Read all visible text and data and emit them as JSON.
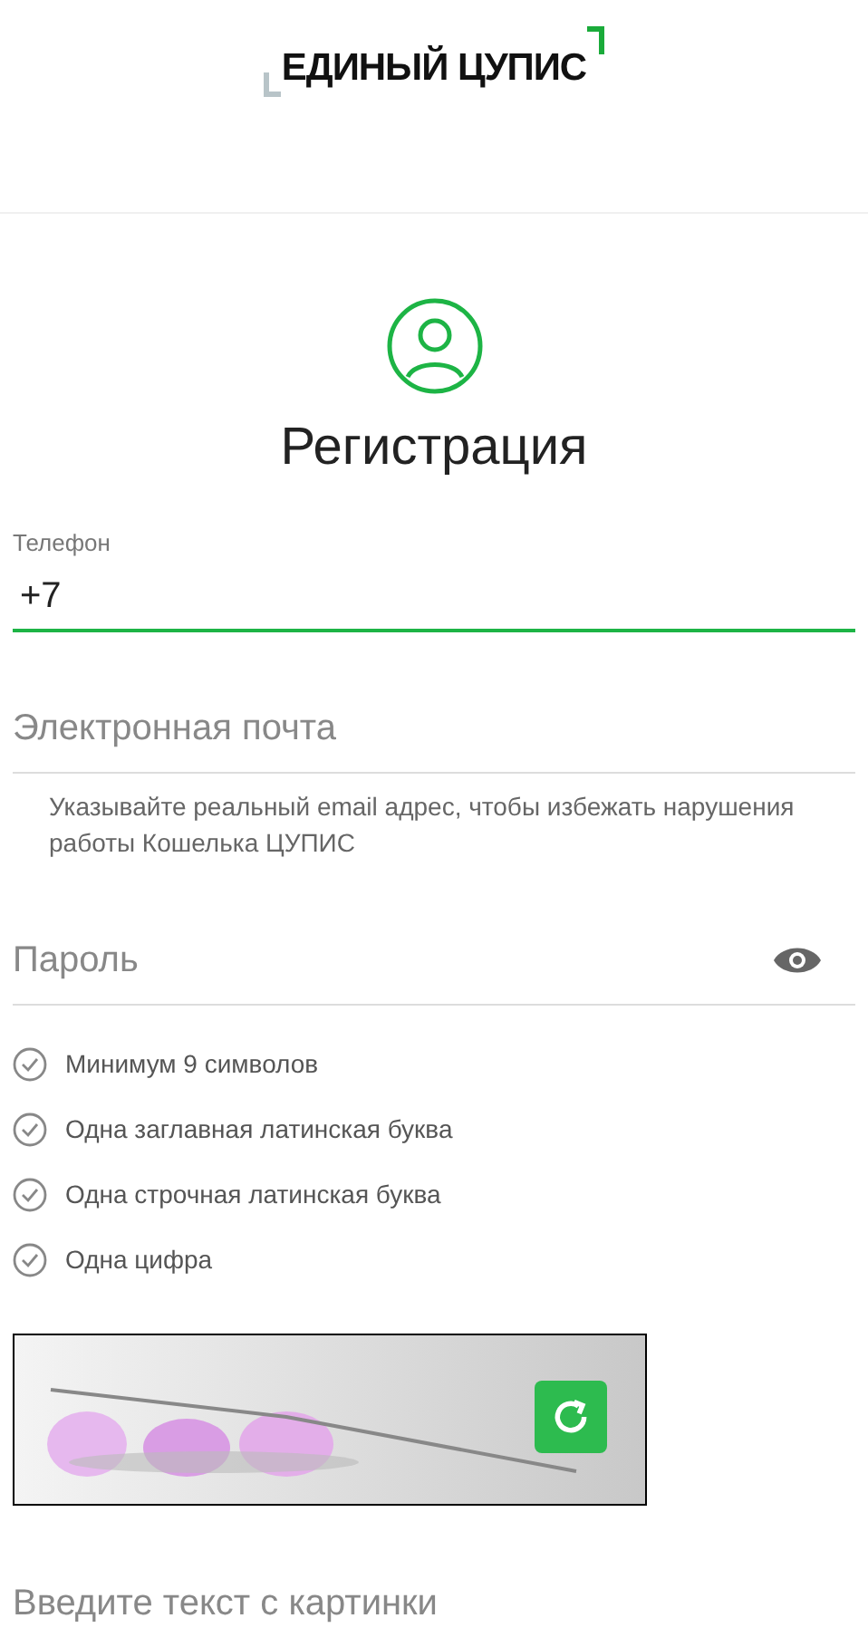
{
  "logo": {
    "text": "ЕДИНЫЙ ЦУПИС"
  },
  "title": "Регистрация",
  "phone": {
    "label": "Телефон",
    "value": "+7",
    "focused": true
  },
  "email": {
    "placeholder": "Электронная почта",
    "hint": "Указывайте реальный email адрес, чтобы избежать нарушения работы Кошелька ЦУПИС"
  },
  "password": {
    "placeholder": "Пароль"
  },
  "rules": [
    {
      "text": "Минимум 9 символов",
      "checked": false
    },
    {
      "text": "Одна заглавная латинская буква",
      "checked": false
    },
    {
      "text": "Одна строчная латинская буква",
      "checked": false
    },
    {
      "text": "Одна цифра",
      "checked": false
    }
  ],
  "captcha_input": {
    "placeholder": "Введите текст с картинки"
  }
}
